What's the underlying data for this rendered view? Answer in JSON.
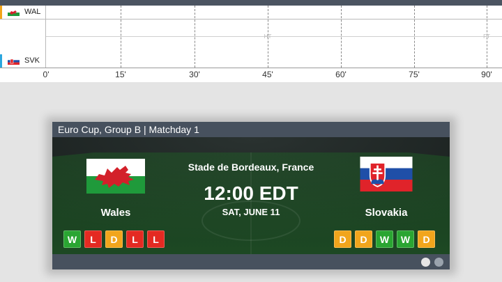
{
  "timeline": {
    "home": {
      "code": "WAL",
      "accent": "#f2a51a"
    },
    "away": {
      "code": "SVK",
      "accent": "#2ba6de"
    },
    "ticks": [
      "0'",
      "15'",
      "30'",
      "45'",
      "60'",
      "75'",
      "90'"
    ],
    "half_marks": [
      "HT",
      "FT"
    ]
  },
  "match": {
    "competition": "Euro Cup, Group B | Matchday 1",
    "venue": "Stade de Bordeaux, France",
    "time": "12:00 EDT",
    "date": "SAT, JUNE 11",
    "home": {
      "name": "Wales",
      "form": [
        "W",
        "L",
        "D",
        "L",
        "L"
      ]
    },
    "away": {
      "name": "Slovakia",
      "form": [
        "D",
        "D",
        "W",
        "W",
        "D"
      ]
    }
  },
  "pager": {
    "dots": 2,
    "active": 0
  },
  "colors": {
    "win": "#2aa532",
    "loss": "#e42a22",
    "draw": "#f1a51c",
    "card_header": "#47515e",
    "pitch": "#1f8a2a"
  }
}
